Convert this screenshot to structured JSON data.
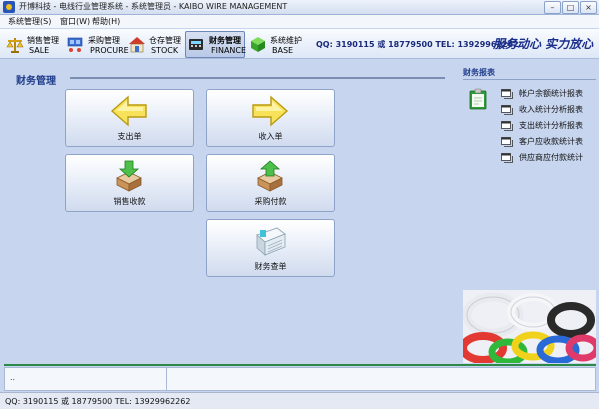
{
  "window": {
    "title": "开博科技 - 电线行业管理系统 - 系统管理员 - KAIBO WIRE MANAGEMENT",
    "controls": {
      "minimize": "–",
      "maximize": "□",
      "close": "×"
    }
  },
  "menu": {
    "items": [
      "系统管理(S)",
      "窗口(W)",
      "帮助(H)"
    ]
  },
  "toolbar": {
    "buttons": [
      {
        "cn": "销售管理",
        "en": "SALE",
        "icon": "scale-icon"
      },
      {
        "cn": "采购管理",
        "en": "PROCURE",
        "icon": "cart-icon"
      },
      {
        "cn": "仓存管理",
        "en": "STOCK",
        "icon": "warehouse-icon"
      },
      {
        "cn": "财务管理",
        "en": "FINANCE",
        "icon": "finance-icon",
        "active": true
      },
      {
        "cn": "系统维护",
        "en": "BASE",
        "icon": "cube-icon"
      }
    ],
    "contact": "QQ: 3190115 或 18779500  TEL: 13929962262",
    "slogan": "服务动心 实力放心"
  },
  "main": {
    "section_title": "财务管理",
    "buttons": {
      "expense": "支出单",
      "income": "收入单",
      "sales_receipt": "销售收款",
      "purchase_payment": "采购付款",
      "account_query": "财务查单"
    }
  },
  "reports": {
    "title": "财务报表",
    "items": [
      "帐户余额统计报表",
      "收入统计分析报表",
      "支出统计分析报表",
      "客户应收款统计表",
      "供应商应付款统计"
    ]
  },
  "log": {
    "text": ".."
  },
  "status": {
    "text": "QQ: 3190115 或 18779500  TEL: 13929962262"
  },
  "colors": {
    "accent": "#1f3c8a",
    "status_line": "#2c8a47",
    "background": "#c7d5ef"
  }
}
